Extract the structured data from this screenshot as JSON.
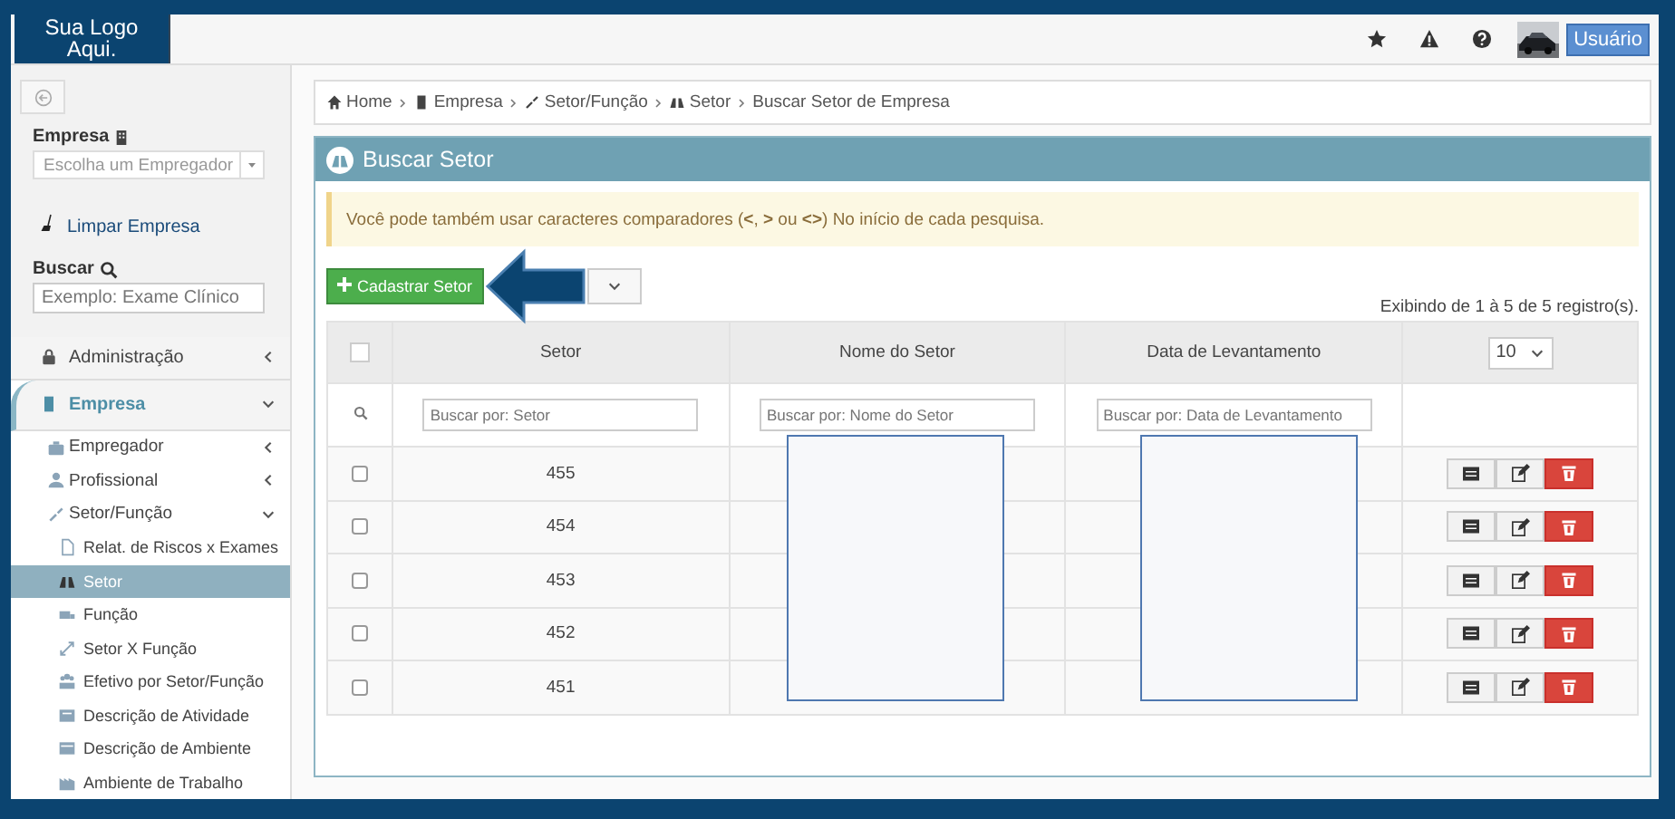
{
  "header": {
    "logo": "Sua Logo Aqui.",
    "user_button": "Usuário"
  },
  "sidebar": {
    "empresa_label": "Empresa",
    "empresa_select": {
      "placeholder": "Escolha um Empregador"
    },
    "clear_link": "Limpar Empresa",
    "search_label": "Buscar",
    "search_field": {
      "placeholder": "Exemplo: Exame Clínico"
    },
    "menu": [
      {
        "label": "Administração",
        "expanded": false,
        "selected": false
      },
      {
        "label": "Empresa",
        "expanded": true,
        "selected": false,
        "children": [
          {
            "label": "Empregador",
            "expanded": false,
            "selected": false
          },
          {
            "label": "Profissional",
            "expanded": false,
            "selected": false
          },
          {
            "label": "Setor/Função",
            "expanded": true,
            "selected": false,
            "children": [
              {
                "label": "Relat. de Riscos x Exames",
                "selected": false
              },
              {
                "label": "Setor",
                "selected": true
              },
              {
                "label": "Função",
                "selected": false
              },
              {
                "label": "Setor X Função",
                "selected": false
              },
              {
                "label": "Efetivo por Setor/Função",
                "selected": false
              },
              {
                "label": "Descrição de Atividade",
                "selected": false
              },
              {
                "label": "Descrição de Ambiente",
                "selected": false
              },
              {
                "label": "Ambiente de Trabalho",
                "selected": false
              }
            ]
          }
        ]
      }
    ]
  },
  "breadcrumb": [
    "Home",
    "Empresa",
    "Setor/Função",
    "Setor",
    "Buscar Setor de Empresa"
  ],
  "panel": {
    "title": "Buscar Setor",
    "alert": "Você pode também usar caracteres comparadores (**<**, **>** ou **<>**) No início de cada pesquisa.",
    "add_button": "Cadastrar Setor",
    "record_info": "Exibindo de 1 à 5 de 5 registro(s).",
    "page_size": "10"
  },
  "table": {
    "header_checkbox": {
      "checked": false
    },
    "columns": [
      "Setor",
      "Nome do Setor",
      "Data de Levantamento"
    ],
    "filters": [
      {
        "placeholder": "Buscar por: Setor"
      },
      {
        "placeholder": "Buscar por: Nome do Setor"
      },
      {
        "placeholder": "Buscar por: Data de Levantamento"
      }
    ],
    "rows": [
      {
        "checked": false,
        "setor": "455"
      },
      {
        "checked": false,
        "setor": "454"
      },
      {
        "checked": false,
        "setor": "453"
      },
      {
        "checked": false,
        "setor": "452"
      },
      {
        "checked": false,
        "setor": "451"
      }
    ]
  }
}
